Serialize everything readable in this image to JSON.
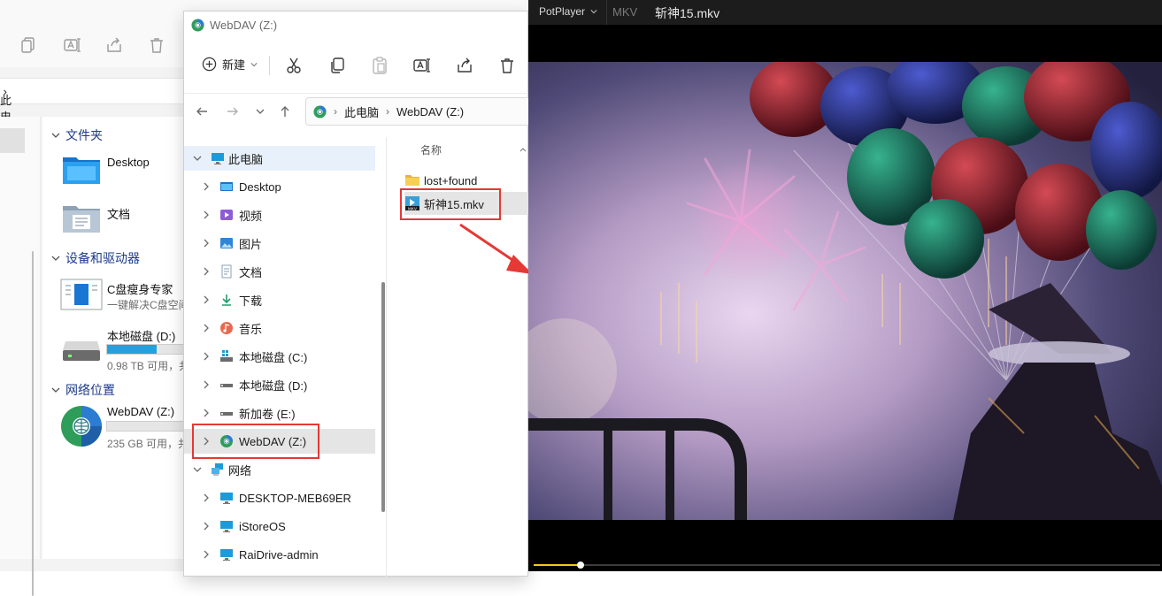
{
  "background_explorer": {
    "breadcrumb": "此电脑",
    "groups": [
      {
        "label": "文件夹"
      },
      {
        "label": "设备和驱动器"
      },
      {
        "label": "网络位置"
      }
    ],
    "folders": [
      {
        "label": "Desktop"
      },
      {
        "label": "文档"
      }
    ],
    "devices": [
      {
        "label": "C盘瘦身专家",
        "sub": "一键解决C盘空间"
      },
      {
        "label": "本地磁盘 (D:)",
        "sub": "0.98 TB 可用，共",
        "used_fraction": 0.65
      }
    ],
    "network_locations": [
      {
        "label": "WebDAV (Z:)",
        "sub": "235 GB 可用，共",
        "used_fraction": 0.0
      }
    ]
  },
  "explorer": {
    "window_title": "WebDAV (Z:)",
    "new_label": "新建",
    "address": {
      "crumbs": [
        "此电脑",
        "WebDAV (Z:)"
      ]
    },
    "tree": [
      {
        "label": "此电脑",
        "icon": "pc-icon",
        "level": 0,
        "expanded": true,
        "selected_bg": true
      },
      {
        "label": "Desktop",
        "icon": "desktop-folder-icon",
        "level": 1
      },
      {
        "label": "视频",
        "icon": "video-folder-icon",
        "level": 1
      },
      {
        "label": "图片",
        "icon": "pictures-folder-icon",
        "level": 1
      },
      {
        "label": "文档",
        "icon": "documents-folder-icon",
        "level": 1
      },
      {
        "label": "下载",
        "icon": "download-icon",
        "level": 1
      },
      {
        "label": "音乐",
        "icon": "music-icon",
        "level": 1
      },
      {
        "label": "本地磁盘 (C:)",
        "icon": "windows-drive-icon",
        "level": 1
      },
      {
        "label": "本地磁盘 (D:)",
        "icon": "drive-icon",
        "level": 1
      },
      {
        "label": "新加卷 (E:)",
        "icon": "drive-icon",
        "level": 1
      },
      {
        "label": "WebDAV (Z:)",
        "icon": "network-drive-icon",
        "level": 1,
        "selected": true
      },
      {
        "label": "网络",
        "icon": "network-icon",
        "level": 0,
        "expanded": true
      },
      {
        "label": "DESKTOP-MEB69ER",
        "icon": "computer-icon",
        "level": 1
      },
      {
        "label": "iStoreOS",
        "icon": "computer-icon",
        "level": 1
      },
      {
        "label": "RaiDrive-admin",
        "icon": "computer-icon",
        "level": 1
      }
    ],
    "files_header": "名称",
    "files": [
      {
        "label": "lost+found",
        "icon": "folder-icon"
      },
      {
        "label": "斩神15.mkv",
        "icon": "mkv-file-icon",
        "selected": true
      }
    ]
  },
  "player": {
    "app_name": "PotPlayer",
    "format": "MKV",
    "file_name": "斩神15.mkv",
    "progress": 0.075
  },
  "colors": {
    "annotation_red": "#e53935",
    "seek_played": "#f5c518",
    "selection_bg": "#e5e5e5",
    "tree_header_bg": "#e8f1fb"
  }
}
